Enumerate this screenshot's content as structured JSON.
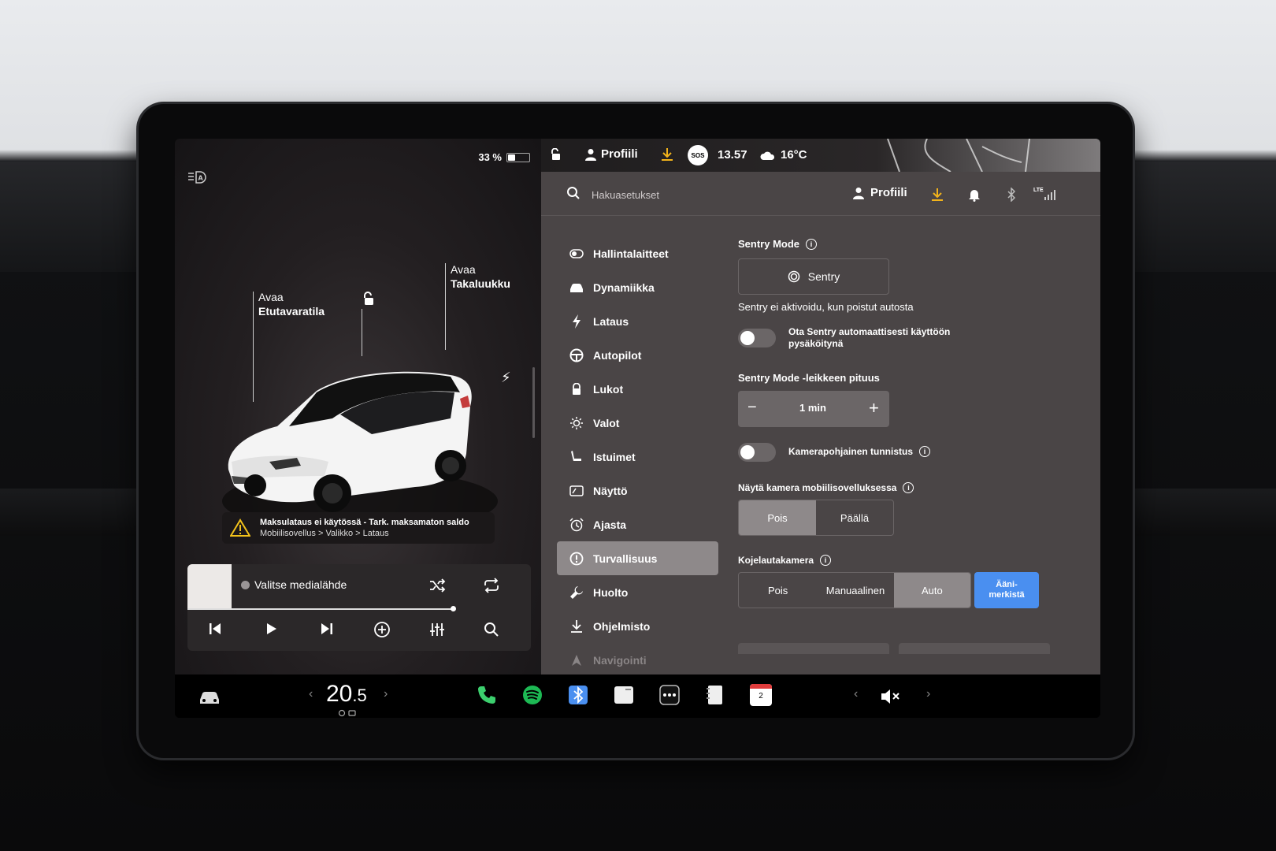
{
  "left_panel": {
    "battery_percent": "33 %",
    "battery_level": 0.33,
    "callouts": {
      "frunk_line1": "Avaa",
      "frunk_line2": "Etutavaratila",
      "trunk_line1": "Avaa",
      "trunk_line2": "Takaluukku"
    },
    "warning": {
      "title": "Maksulataus ei käytössä - Tark. maksamaton saldo",
      "path": "Mobiilisovellus > Valikko > Lataus"
    }
  },
  "media": {
    "source_label": "Valitse medialähde"
  },
  "status_bar": {
    "profile": "Profiili",
    "sos": "SOS",
    "time": "13.57",
    "temperature": "16°C"
  },
  "settings_header": {
    "search_placeholder": "Hakuasetukset",
    "profile": "Profiili",
    "lte": "LTE"
  },
  "sidebar": {
    "items": [
      {
        "label": "Hallintalaitteet",
        "icon": "toggle-icon"
      },
      {
        "label": "Dynamiikka",
        "icon": "car-icon"
      },
      {
        "label": "Lataus",
        "icon": "bolt-icon"
      },
      {
        "label": "Autopilot",
        "icon": "steering-wheel-icon"
      },
      {
        "label": "Lukot",
        "icon": "lock-icon"
      },
      {
        "label": "Valot",
        "icon": "sun-icon"
      },
      {
        "label": "Istuimet",
        "icon": "seat-icon"
      },
      {
        "label": "Näyttö",
        "icon": "display-icon"
      },
      {
        "label": "Ajasta",
        "icon": "alarm-icon"
      },
      {
        "label": "Turvallisuus",
        "icon": "safety-icon"
      },
      {
        "label": "Huolto",
        "icon": "wrench-icon"
      },
      {
        "label": "Ohjelmisto",
        "icon": "download-icon"
      },
      {
        "label": "Navigointi",
        "icon": "navigation-icon"
      }
    ],
    "active": "Turvallisuus"
  },
  "security": {
    "sentry_mode_label": "Sentry Mode",
    "sentry_button": "Sentry",
    "sentry_status": "Sentry ei aktivoidu, kun poistut autosta",
    "auto_sentry_line1": "Ota Sentry automaattisesti käyttöön",
    "auto_sentry_line2": "pysäköitynä",
    "clip_length_label": "Sentry Mode -leikkeen pituus",
    "clip_minus": "−",
    "clip_value": "1 min",
    "clip_plus": "+",
    "camera_detection_label": "Kamerapohjainen tunnistus",
    "mobile_camera_label": "Näytä kamera mobiilisovelluksessa",
    "mobile_camera_options": [
      "Pois",
      "Päällä"
    ],
    "mobile_camera_selected": "Pois",
    "dashcam_label": "Kojelautakamera",
    "dashcam_options": [
      "Pois",
      "Manuaalinen",
      "Auto"
    ],
    "dashcam_selected": "Auto",
    "dashcam_honk_line1": "Ääni-",
    "dashcam_honk_line2": "merkistä"
  },
  "dock": {
    "temperature_int": "20",
    "temperature_dec": ".5",
    "calendar_day": "2"
  },
  "colors": {
    "accent_blue": "#4a8ff0",
    "highlight_yellow": "#f2b31b",
    "spotify_green": "#1db954",
    "phone_green": "#3ccf6e",
    "calendar_red": "#e03b3b"
  }
}
